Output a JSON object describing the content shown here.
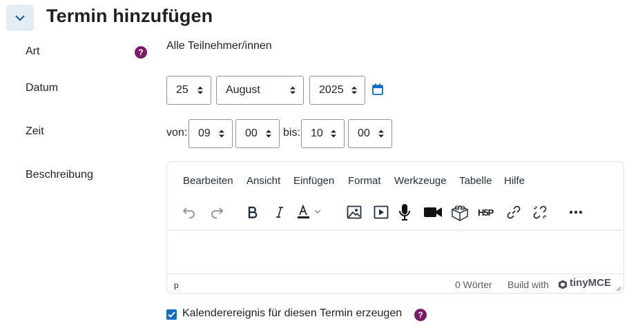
{
  "section": {
    "title": "Termin hinzufügen"
  },
  "fields": {
    "art": {
      "label": "Art",
      "value": "Alle Teilnehmer/innen"
    },
    "datum": {
      "label": "Datum",
      "day": "25",
      "month": "August",
      "year": "2025"
    },
    "zeit": {
      "label": "Zeit",
      "from_label": "von:",
      "from_hour": "09",
      "from_minute": "00",
      "to_label": "bis:",
      "to_hour": "10",
      "to_minute": "00"
    },
    "beschreibung": {
      "label": "Beschreibung"
    }
  },
  "editor": {
    "menu": [
      "Bearbeiten",
      "Ansicht",
      "Einfügen",
      "Format",
      "Werkzeuge",
      "Tabelle",
      "Hilfe"
    ],
    "path": "p",
    "word_count": "0 Wörter",
    "branding_prefix": "Build with",
    "branding_name": "tinyMCE"
  },
  "checkbox": {
    "label": "Kalenderereignis für diesen Termin erzeugen",
    "checked": true
  },
  "colors": {
    "accent": "#0f6cbf",
    "help": "#7a1a69",
    "collapse_bg": "#e4ecf4"
  },
  "icons": [
    "chevron-down-icon",
    "help-icon",
    "calendar-icon",
    "undo-icon",
    "redo-icon",
    "bold-icon",
    "italic-icon",
    "text-color-icon",
    "image-icon",
    "media-icon",
    "microphone-icon",
    "video-camera-icon",
    "brick-icon",
    "h5p-icon",
    "link-icon",
    "unlink-icon",
    "more-icon",
    "resize-icon",
    "checkmark-icon"
  ]
}
